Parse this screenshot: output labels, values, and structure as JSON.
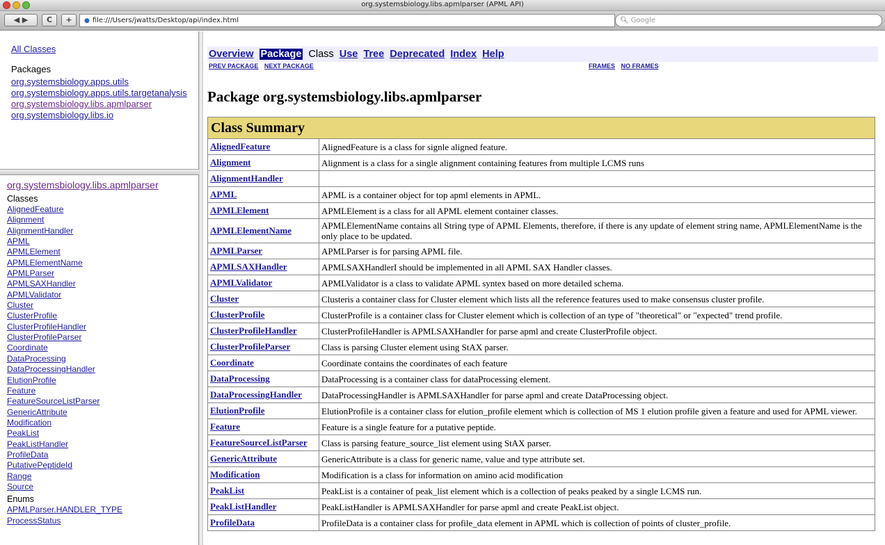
{
  "window": {
    "title": "org.systemsbiology.libs.apmlparser (APML API)"
  },
  "toolbar": {
    "back_forward": "◀ ▶",
    "reload": "C",
    "add": "+",
    "url": "file:///Users/jwatts/Desktop/api/index.html",
    "search_placeholder": "Google"
  },
  "packages_frame": {
    "all_classes": "All Classes",
    "header": "Packages",
    "packages": [
      "org.systemsbiology.apps.utils",
      "org.systemsbiology.apps.utils.targetanalysis",
      "org.systemsbiology.libs.apmlparser",
      "org.systemsbiology.libs.io"
    ]
  },
  "classes_frame": {
    "package": "org.systemsbiology.libs.apmlparser",
    "classes_header": "Classes",
    "classes": [
      "AlignedFeature",
      "Alignment",
      "AlignmentHandler",
      "APML",
      "APMLElement",
      "APMLElementName",
      "APMLParser",
      "APMLSAXHandler",
      "APMLValidator",
      "Cluster",
      "ClusterProfile",
      "ClusterProfileHandler",
      "ClusterProfileParser",
      "Coordinate",
      "DataProcessing",
      "DataProcessingHandler",
      "ElutionProfile",
      "Feature",
      "FeatureSourceListParser",
      "GenericAttribute",
      "Modification",
      "PeakList",
      "PeakListHandler",
      "ProfileData",
      "PutativePeptideId",
      "Range",
      "Source"
    ],
    "enums_header": "Enums",
    "enums": [
      "APMLParser.HANDLER_TYPE",
      "ProcessStatus"
    ]
  },
  "main": {
    "nav": {
      "overview": "Overview",
      "package": "Package",
      "class": "Class",
      "use": "Use",
      "tree": "Tree",
      "deprecated": "Deprecated",
      "index": "Index",
      "help": "Help"
    },
    "subnav": {
      "prev": "PREV PACKAGE",
      "next": "NEXT PACKAGE",
      "frames": "FRAMES",
      "noframes": "NO FRAMES"
    },
    "heading": "Package org.systemsbiology.libs.apmlparser",
    "summary_title": "Class Summary",
    "rows": [
      [
        "AlignedFeature",
        "AlignedFeature is a class for signle aligned feature."
      ],
      [
        "Alignment",
        "Alignment is a class for a single alignment containing features from multiple LCMS runs"
      ],
      [
        "AlignmentHandler",
        ""
      ],
      [
        "APML",
        "APML is a container object for top apml elements in APML."
      ],
      [
        "APMLElement",
        "APMLElement is a class for all APML element container classes."
      ],
      [
        "APMLElementName",
        "APMLElementName contains all String type of APML Elements, therefore, if there is any update of element string name, APMLElementName is the only place to be updated."
      ],
      [
        "APMLParser",
        "APMLParser is for parsing APML file."
      ],
      [
        "APMLSAXHandler",
        "APMLSAXHandlerI should be implemented in all APML SAX Handler classes."
      ],
      [
        "APMLValidator",
        "APMLValidator is a class to validate APML syntex based on more detailed schema."
      ],
      [
        "Cluster",
        "Clusteris a container class for Cluster element which lists all the reference features used to make consensus cluster profile."
      ],
      [
        "ClusterProfile",
        "ClusterProfile is a container class for Cluster element which is collection of an type of \"theoretical\" or \"expected\" trend profile."
      ],
      [
        "ClusterProfileHandler",
        "ClusterProfileHandler is APMLSAXHandler for parse apml and create ClusterProfile object."
      ],
      [
        "ClusterProfileParser",
        "Class is parsing Cluster element using StAX parser."
      ],
      [
        "Coordinate",
        "Coordinate contains the coordinates of each feature"
      ],
      [
        "DataProcessing",
        "DataProcessing is a container class for dataProcessing element."
      ],
      [
        "DataProcessingHandler",
        "DataProcessingHandler is APMLSAXHandler for parse apml and create DataProcessing object."
      ],
      [
        "ElutionProfile",
        "ElutionProfile is a container class for elution_profile element which is collection of MS 1 elution profile given a feature and used for APML viewer."
      ],
      [
        "Feature",
        "Feature is a single feature for a putative peptide."
      ],
      [
        "FeatureSourceListParser",
        "Class is parsing feature_source_list element using StAX parser."
      ],
      [
        "GenericAttribute",
        "GenericAttribute is a class for generic name, value and type attribute set."
      ],
      [
        "Modification",
        "Modification is a class for information on amino acid modification"
      ],
      [
        "PeakList",
        "PeakList is a container of peak_list element which is a collection of peaks peaked by a single LCMS run."
      ],
      [
        "PeakListHandler",
        "PeakListHandler is APMLSAXHandler for parse apml and create PeakList object."
      ],
      [
        "ProfileData",
        "ProfileData is a container class for profile_data element in APML which is collection of points of cluster_profile."
      ]
    ]
  }
}
